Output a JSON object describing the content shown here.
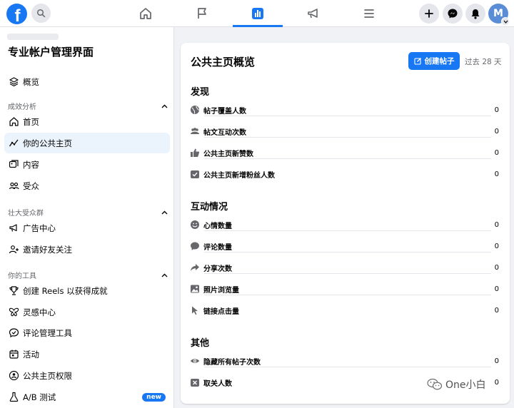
{
  "colors": {
    "accent": "#1877f2",
    "text": "#050505",
    "muted": "#65676b",
    "background": "#f0f2f5"
  },
  "topbar": {
    "avatar_initial": "M",
    "tabs": [
      {
        "name": "home-icon",
        "active": false
      },
      {
        "name": "flag-icon",
        "active": false
      },
      {
        "name": "insights-icon",
        "active": true
      },
      {
        "name": "megaphone-icon",
        "active": false
      },
      {
        "name": "menu-icon",
        "active": false
      }
    ]
  },
  "sidebar": {
    "title": "专业帐户管理界面",
    "overview_label": "概览",
    "sections": [
      {
        "title": "成效分析",
        "items": [
          "首页",
          "你的公共主页",
          "内容",
          "受众"
        ]
      },
      {
        "title": "壮大受众群",
        "items": [
          "广告中心",
          "邀请好友关注"
        ]
      },
      {
        "title": "你的工具",
        "items": [
          "创建 Reels 以获得成就",
          "灵感中心",
          "评论管理工具",
          "活动",
          "公共主页权限",
          "A/B 测试"
        ]
      }
    ],
    "active_item": "你的公共主页",
    "new_badge": "new"
  },
  "main": {
    "title": "公共主页概览",
    "create_post_label": "创建帖子",
    "period_label": "过去 28 天",
    "groups": [
      {
        "title": "发现",
        "metrics": [
          {
            "label": "帖子覆盖人数",
            "value": "0",
            "icon": "globe-icon"
          },
          {
            "label": "帖文互动次数",
            "value": "0",
            "icon": "people-icon"
          },
          {
            "label": "公共主页新赞数",
            "value": "0",
            "icon": "thumbs-up-icon"
          },
          {
            "label": "公共主页新增粉丝人数",
            "value": "0",
            "icon": "follow-check-icon"
          }
        ]
      },
      {
        "title": "互动情况",
        "metrics": [
          {
            "label": "心情数量",
            "value": "0",
            "icon": "smiley-icon"
          },
          {
            "label": "评论数量",
            "value": "0",
            "icon": "comment-icon"
          },
          {
            "label": "分享次数",
            "value": "0",
            "icon": "share-icon"
          },
          {
            "label": "照片浏览量",
            "value": "0",
            "icon": "photo-icon"
          },
          {
            "label": "链接点击量",
            "value": "0",
            "icon": "cursor-icon"
          }
        ]
      },
      {
        "title": "其他",
        "metrics": [
          {
            "label": "隐藏所有帖子次数",
            "value": "0",
            "icon": "eye-icon"
          },
          {
            "label": "取关人数",
            "value": "0",
            "icon": "unfollow-icon"
          }
        ]
      }
    ]
  },
  "watermark": "One小白"
}
